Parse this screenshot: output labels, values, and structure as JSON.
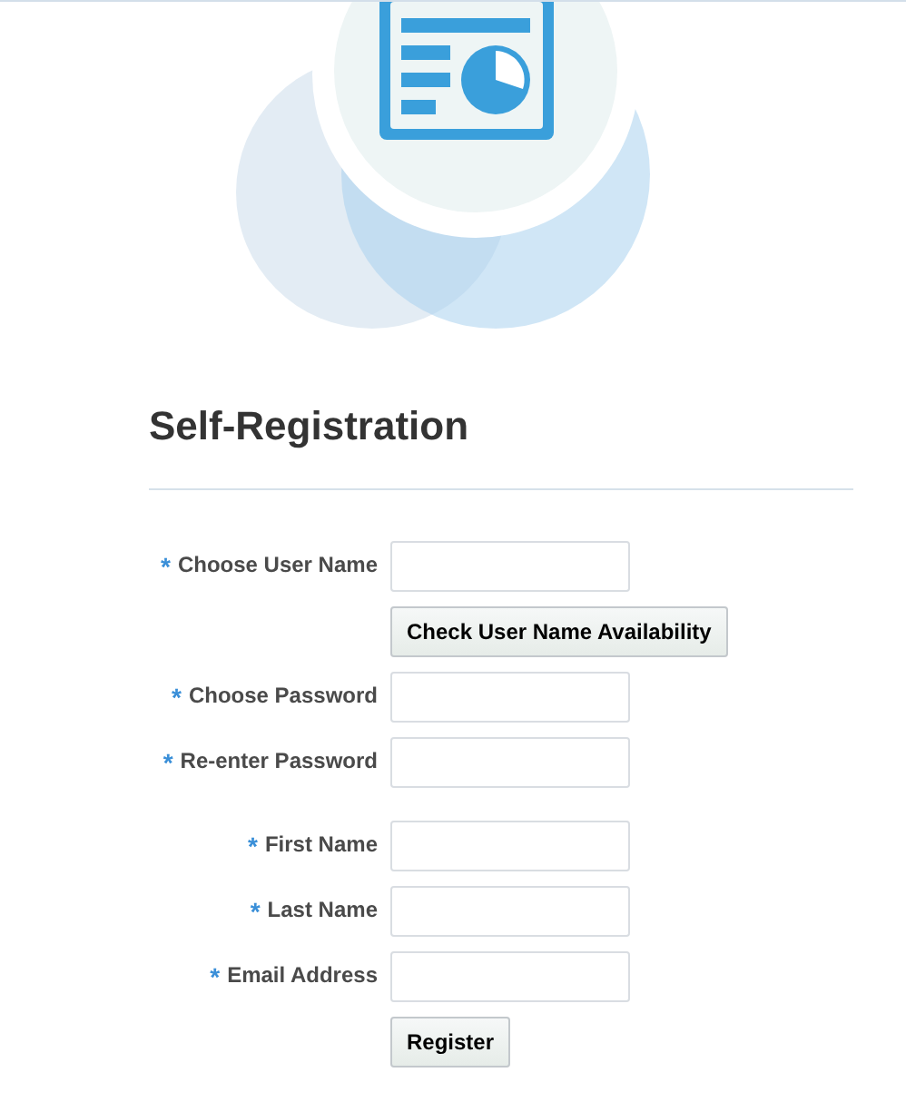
{
  "title": "Self-Registration",
  "form": {
    "groups": [
      [
        {
          "kind": "field",
          "required_mark": "*",
          "label": "Choose User Name"
        },
        {
          "kind": "button",
          "label": "Check User Name Availability"
        },
        {
          "kind": "field",
          "required_mark": "*",
          "label": "Choose Password"
        },
        {
          "kind": "field",
          "required_mark": "*",
          "label": "Re-enter Password"
        }
      ],
      [
        {
          "kind": "field",
          "required_mark": "*",
          "label": "First Name"
        },
        {
          "kind": "field",
          "required_mark": "*",
          "label": "Last Name"
        },
        {
          "kind": "field",
          "required_mark": "*",
          "label": "Email Address"
        },
        {
          "kind": "button",
          "label": "Register"
        }
      ]
    ]
  }
}
